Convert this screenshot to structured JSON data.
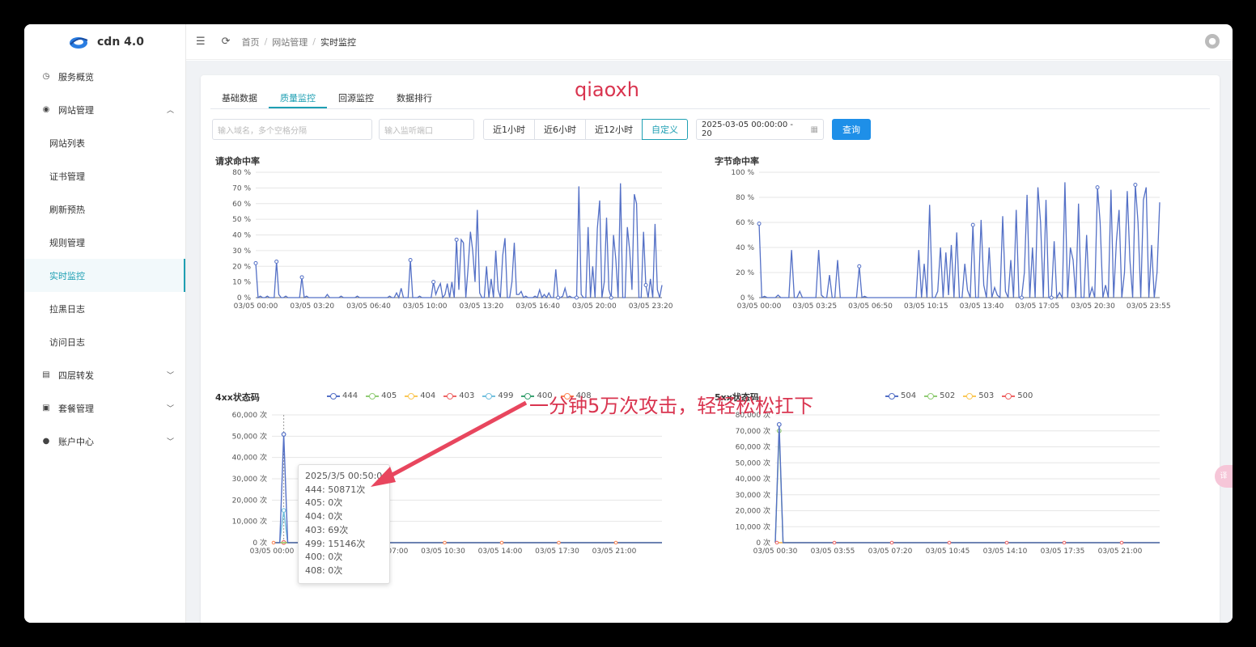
{
  "app": {
    "title": "cdn 4.0"
  },
  "sidebar": {
    "items": [
      {
        "label": "服务概览",
        "icon": "clock-icon"
      },
      {
        "label": "网站管理",
        "icon": "globe-icon",
        "expanded": true
      },
      {
        "label": "网站列表",
        "sub": true
      },
      {
        "label": "证书管理",
        "sub": true
      },
      {
        "label": "刷新预热",
        "sub": true
      },
      {
        "label": "规则管理",
        "sub": true
      },
      {
        "label": "实时监控",
        "sub": true,
        "active": true
      },
      {
        "label": "拉黑日志",
        "sub": true
      },
      {
        "label": "访问日志",
        "sub": true
      },
      {
        "label": "四层转发",
        "icon": "server-icon",
        "collapsed": true
      },
      {
        "label": "套餐管理",
        "icon": "package-icon",
        "collapsed": true
      },
      {
        "label": "账户中心",
        "icon": "user-icon",
        "collapsed": true
      }
    ]
  },
  "breadcrumb": [
    "首页",
    "网站管理",
    "实时监控"
  ],
  "tabs": [
    "基础数据",
    "质量监控",
    "回源监控",
    "数据排行"
  ],
  "active_tab": 1,
  "watermarks": {
    "top": "qiaoxh",
    "middle": "一分钟5万次攻击，轻轻松松扛下"
  },
  "filters": {
    "domain_placeholder": "输入域名，多个空格分隔",
    "port_placeholder": "输入监听端口",
    "ranges": [
      "近1小时",
      "近6小时",
      "近12小时",
      "自定义"
    ],
    "active_range": 3,
    "date_value": "2025-03-05 00:00:00 - 20",
    "query_label": "查询"
  },
  "tooltip": {
    "title": "2025/3/5 00:50:0",
    "rows": [
      "444: 50871次",
      "405: 0次",
      "404: 0次",
      "403: 69次",
      "499: 15146次",
      "400: 0次",
      "408: 0次"
    ]
  },
  "colors": {
    "accent": "#1e9fb3",
    "line": "#5470c6",
    "query": "#1e8fe8",
    "watermark": "#d9344f"
  },
  "chart_data": [
    {
      "type": "line",
      "title": "请求命中率",
      "x_ticks": [
        "03/05 00:00",
        "03/05 03:20",
        "03/05 06:40",
        "03/05 10:00",
        "03/05 13:20",
        "03/05 16:40",
        "03/05 20:00",
        "03/05 23:20"
      ],
      "y_ticks": [
        "0 %",
        "10 %",
        "20 %",
        "30 %",
        "40 %",
        "50 %",
        "60 %",
        "70 %",
        "80 %"
      ],
      "ylim": [
        0,
        80
      ],
      "color": "#5470c6",
      "values": [
        22,
        0,
        1,
        0,
        0,
        1,
        0,
        0,
        0,
        23,
        2,
        0,
        0,
        1,
        0,
        0,
        0,
        0,
        0,
        0,
        13,
        0,
        1,
        0,
        0,
        0,
        0,
        0,
        0,
        0,
        0,
        2,
        0,
        0,
        0,
        0,
        0,
        1,
        0,
        0,
        0,
        0,
        0,
        0,
        1,
        0,
        0,
        0,
        0,
        0,
        0,
        0,
        0,
        0,
        0,
        0,
        0,
        0,
        1,
        0,
        0,
        3,
        0,
        6,
        0,
        0,
        0,
        24,
        0,
        0,
        0,
        1,
        0,
        0,
        0,
        0,
        0,
        10,
        2,
        6,
        9,
        0,
        2,
        9,
        0,
        10,
        0,
        37,
        5,
        37,
        35,
        0,
        19,
        42,
        30,
        10,
        56,
        3,
        0,
        0,
        20,
        0,
        12,
        0,
        30,
        5,
        0,
        27,
        38,
        0,
        0,
        10,
        35,
        2,
        2,
        4,
        0,
        1,
        0,
        0,
        0,
        1,
        0,
        5,
        0,
        2,
        0,
        3,
        0,
        0,
        18,
        0,
        0,
        1,
        6,
        0,
        1,
        0,
        0,
        0,
        71,
        2,
        0,
        0,
        45,
        0,
        20,
        0,
        44,
        62,
        0,
        10,
        51,
        5,
        0,
        40,
        24,
        0,
        73,
        0,
        0,
        45,
        30,
        5,
        66,
        60,
        0,
        0,
        42,
        8,
        0,
        12,
        0,
        47,
        5,
        0,
        8
      ],
      "markers": [
        0,
        9,
        20,
        67,
        77,
        87,
        131,
        139,
        154,
        169
      ]
    },
    {
      "type": "line",
      "title": "字节命中率",
      "x_ticks": [
        "03/05 00:00",
        "03/05 03:25",
        "03/05 06:50",
        "03/05 10:15",
        "03/05 13:40",
        "03/05 17:05",
        "03/05 20:30",
        "03/05 23:55"
      ],
      "y_ticks": [
        "0 %",
        "20 %",
        "40 %",
        "60 %",
        "80 %",
        "100 %"
      ],
      "ylim": [
        0,
        100
      ],
      "color": "#5470c6",
      "values": [
        59,
        0,
        1,
        0,
        0,
        0,
        0,
        2,
        0,
        0,
        0,
        0,
        38,
        0,
        0,
        5,
        0,
        0,
        0,
        0,
        0,
        0,
        38,
        2,
        0,
        0,
        18,
        0,
        0,
        30,
        0,
        0,
        0,
        0,
        0,
        0,
        0,
        25,
        0,
        1,
        0,
        0,
        0,
        0,
        0,
        0,
        0,
        0,
        0,
        0,
        0,
        0,
        0,
        0,
        0,
        0,
        0,
        0,
        0,
        38,
        0,
        27,
        0,
        74,
        0,
        0,
        5,
        40,
        0,
        36,
        2,
        42,
        0,
        52,
        0,
        0,
        27,
        6,
        0,
        58,
        0,
        0,
        62,
        10,
        0,
        40,
        0,
        8,
        2,
        0,
        65,
        5,
        0,
        30,
        0,
        70,
        0,
        0,
        20,
        82,
        0,
        40,
        0,
        88,
        60,
        0,
        78,
        0,
        0,
        45,
        0,
        4,
        0,
        92,
        0,
        40,
        30,
        0,
        75,
        0,
        0,
        50,
        0,
        8,
        0,
        88,
        60,
        0,
        10,
        0,
        86,
        0,
        45,
        70,
        0,
        20,
        85,
        30,
        0,
        90,
        60,
        0,
        78,
        88,
        0,
        42,
        0,
        20,
        76
      ],
      "markers": [
        0,
        37,
        79,
        97,
        108,
        125,
        139,
        157
      ]
    },
    {
      "type": "line",
      "title": "4xx状态码",
      "x_ticks": [
        "03/05 00:00",
        "03/05 03:30",
        "03/05 07:00",
        "03/05 10:30",
        "03/05 14:00",
        "03/05 17:30",
        "03/05 21:00"
      ],
      "y_ticks": [
        "0 次",
        "10,000 次",
        "20,000 次",
        "30,000 次",
        "40,000 次",
        "50,000 次",
        "60,000 次"
      ],
      "ylim": [
        0,
        60000
      ],
      "series": [
        {
          "name": "444",
          "color": "#5470c6",
          "spike": 50871
        },
        {
          "name": "405",
          "color": "#91cc75",
          "spike": 0
        },
        {
          "name": "404",
          "color": "#fac858",
          "spike": 0
        },
        {
          "name": "403",
          "color": "#ee6666",
          "spike": 69
        },
        {
          "name": "499",
          "color": "#73c0de",
          "spike": 15146
        },
        {
          "name": "400",
          "color": "#3ba272",
          "spike": 0
        },
        {
          "name": "408",
          "color": "#fc8452",
          "spike": 0
        }
      ]
    },
    {
      "type": "line",
      "title": "5xx状态码",
      "x_ticks": [
        "03/05 00:30",
        "03/05 03:55",
        "03/05 07:20",
        "03/05 10:45",
        "03/05 14:10",
        "03/05 17:35",
        "03/05 21:00"
      ],
      "y_ticks": [
        "0 次",
        "10,000 次",
        "20,000 次",
        "30,000 次",
        "40,000 次",
        "50,000 次",
        "60,000 次",
        "70,000 次",
        "80,000 次"
      ],
      "ylim": [
        0,
        80000
      ],
      "series": [
        {
          "name": "504",
          "color": "#5470c6",
          "spike": 74000
        },
        {
          "name": "502",
          "color": "#91cc75",
          "spike": 70000
        },
        {
          "name": "503",
          "color": "#fac858",
          "spike": 0
        },
        {
          "name": "500",
          "color": "#ee6666",
          "spike": 0
        }
      ]
    }
  ]
}
